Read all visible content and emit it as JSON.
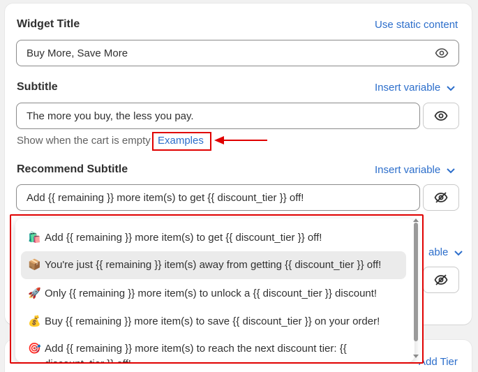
{
  "widget_title": {
    "label": "Widget Title",
    "link": "Use static content",
    "value": "Buy More, Save More"
  },
  "subtitle": {
    "label": "Subtitle",
    "link": "Insert variable",
    "value": "The more you buy, the less you pay.",
    "hint": "Show when the cart is empty",
    "examples_link": "Examples"
  },
  "recommend_subtitle": {
    "label": "Recommend Subtitle",
    "link": "Insert variable",
    "value": "Add {{ remaining }} more item(s) to get {{ discount_tier }} off!"
  },
  "hidden_section": {
    "link_partial": "able"
  },
  "add_tier_link": "Add Tier",
  "dropdown": {
    "items": [
      {
        "emoji": "🛍️",
        "text": "Add {{ remaining }} more item(s) to get {{ discount_tier }} off!"
      },
      {
        "emoji": "📦",
        "text": "You're just {{ remaining }} item(s) away from getting {{ discount_tier }} off!"
      },
      {
        "emoji": "🚀",
        "text": "Only {{ remaining }} more item(s) to unlock a {{ discount_tier }} discount!"
      },
      {
        "emoji": "💰",
        "text": "Buy {{ remaining }} more item(s) to save {{ discount_tier }} on your order!"
      },
      {
        "emoji": "🎯",
        "text": "Add {{ remaining }} more item(s) to reach the next discount tier: {{ discount_tier }} off!"
      }
    ]
  },
  "colors": {
    "link": "#2c6ecb",
    "annotation": "#e00000",
    "hover": "#ebebeb"
  }
}
